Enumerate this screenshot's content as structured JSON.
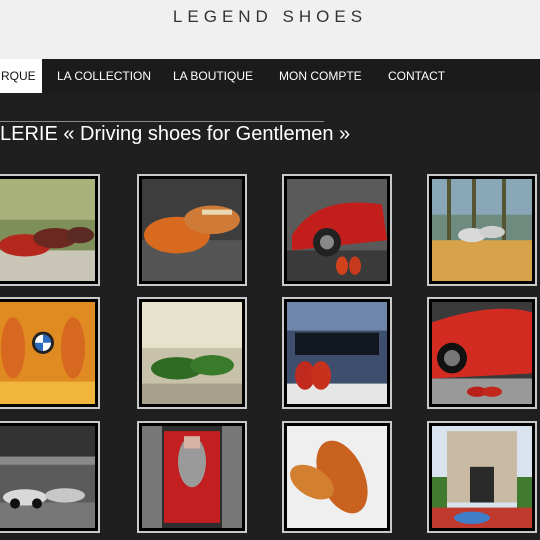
{
  "site": {
    "logo": "LEGEND SHOES"
  },
  "nav": {
    "items": [
      {
        "label": "RQUE",
        "active": true
      },
      {
        "label": "LA COLLECTION",
        "active": false
      },
      {
        "label": "LA BOUTIQUE",
        "active": false
      },
      {
        "label": "MON COMPTE",
        "active": false
      },
      {
        "label": "CONTACT",
        "active": false
      }
    ]
  },
  "gallery": {
    "title": "LERIE « Driving shoes for Gentlemen »",
    "items": [
      {
        "subject": "red-shoes-on-grass"
      },
      {
        "subject": "orange-shoe-closeup"
      },
      {
        "subject": "red-car-with-shoes"
      },
      {
        "subject": "grey-shoes-on-deck"
      },
      {
        "subject": "bmw-orange-shoes"
      },
      {
        "subject": "green-shoes"
      },
      {
        "subject": "maserati-red-shoes"
      },
      {
        "subject": "red-ferrari-shoes"
      },
      {
        "subject": "vintage-race-cars"
      },
      {
        "subject": "engine-grey-shoe"
      },
      {
        "subject": "orange-shoe-white"
      },
      {
        "subject": "building-blue-shoes"
      }
    ]
  },
  "colors": {
    "nav_bg": "#1b1b1b",
    "header_bg": "#f0f0f0",
    "page_bg": "#1f1f1f",
    "accent_red": "#c0281c",
    "accent_orange": "#d9691e"
  }
}
